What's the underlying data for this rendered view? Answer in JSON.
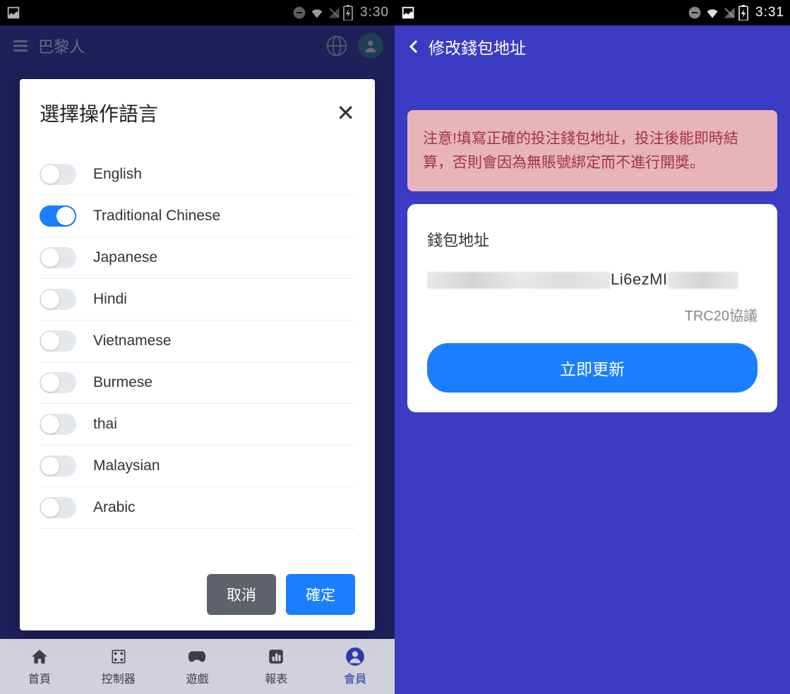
{
  "left": {
    "status": {
      "time": "3:30"
    },
    "header": {
      "title": "巴黎人"
    },
    "modal": {
      "title": "選擇操作語言",
      "languages": [
        {
          "label": "English",
          "on": false
        },
        {
          "label": "Traditional Chinese",
          "on": true
        },
        {
          "label": "Japanese",
          "on": false
        },
        {
          "label": "Hindi",
          "on": false
        },
        {
          "label": "Vietnamese",
          "on": false
        },
        {
          "label": "Burmese",
          "on": false
        },
        {
          "label": "thai",
          "on": false
        },
        {
          "label": "Malaysian",
          "on": false
        },
        {
          "label": "Arabic",
          "on": false
        }
      ],
      "cancel_label": "取消",
      "ok_label": "確定"
    },
    "nav": {
      "items": [
        {
          "label": "首頁",
          "icon": "home"
        },
        {
          "label": "控制器",
          "icon": "controller"
        },
        {
          "label": "遊戲",
          "icon": "game"
        },
        {
          "label": "報表",
          "icon": "chart"
        },
        {
          "label": "會員",
          "icon": "member",
          "active": true
        }
      ]
    }
  },
  "right": {
    "status": {
      "time": "3:31"
    },
    "header": {
      "title": "修改錢包地址"
    },
    "warning": "注意!填寫正確的投注錢包地址，投注後能即時結算，否則會因為無賬號綁定而不進行開獎。",
    "card": {
      "label": "錢包地址",
      "address_visible": "Li6ezMI",
      "protocol": "TRC20協議",
      "update_label": "立即更新"
    }
  }
}
